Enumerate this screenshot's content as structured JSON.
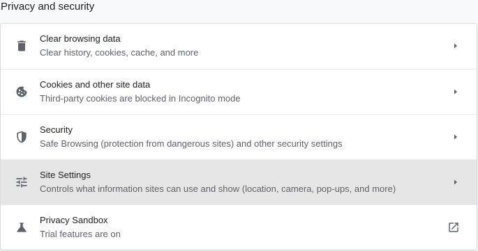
{
  "section": {
    "title": "Privacy and security"
  },
  "items": [
    {
      "title": "Clear browsing data",
      "subtitle": "Clear history, cookies, cache, and more",
      "icon": "trash-icon",
      "action_icon": "chevron-right-icon"
    },
    {
      "title": "Cookies and other site data",
      "subtitle": "Third-party cookies are blocked in Incognito mode",
      "icon": "cookie-icon",
      "action_icon": "chevron-right-icon"
    },
    {
      "title": "Security",
      "subtitle": "Safe Browsing (protection from dangerous sites) and other security settings",
      "icon": "shield-icon",
      "action_icon": "chevron-right-icon"
    },
    {
      "title": "Site Settings",
      "subtitle": "Controls what information sites can use and show (location, camera, pop-ups, and more)",
      "icon": "tune-sliders-icon",
      "action_icon": "chevron-right-icon",
      "hovered": true
    },
    {
      "title": "Privacy Sandbox",
      "subtitle": "Trial features are on",
      "icon": "flask-icon",
      "action_icon": "open-in-new-icon"
    }
  ],
  "colors": {
    "page_background": "#f8f9fa",
    "card_background": "#ffffff",
    "hover_background": "#e6e6e6",
    "primary_text": "#202124",
    "secondary_text": "#5f6368",
    "icon": "#5f6368",
    "divider": "#e8eaed"
  }
}
